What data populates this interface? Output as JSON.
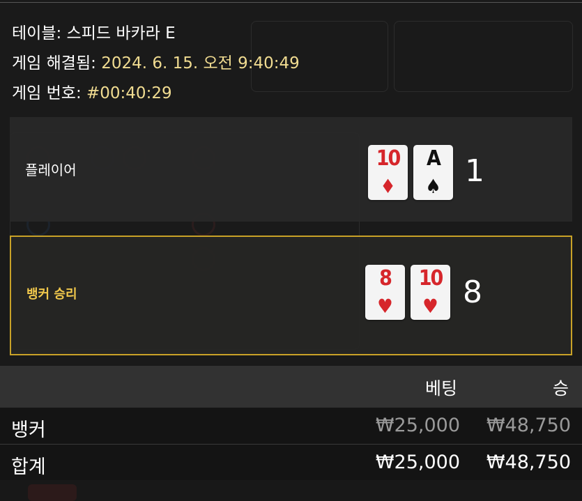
{
  "info": {
    "table_label": "테이블:",
    "table_value": "스피드 바카라 E",
    "time_label": "게임 해결됨:",
    "time_value": "2024. 6. 15. 오전 9:40:49",
    "round_label": "게임 번호:",
    "round_value": "#00:40:29"
  },
  "player": {
    "label": "플레이어",
    "score": "1",
    "cards": [
      {
        "rank": "10",
        "suit": "♦",
        "color": "red"
      },
      {
        "rank": "A",
        "suit": "♠",
        "color": "black"
      }
    ]
  },
  "banker": {
    "label": "뱅커 승리",
    "score": "8",
    "cards": [
      {
        "rank": "8",
        "suit": "♥",
        "color": "red"
      },
      {
        "rank": "10",
        "suit": "♥",
        "color": "red"
      }
    ]
  },
  "bets": {
    "header_bet": "베팅",
    "header_win": "승",
    "rows": [
      {
        "name": "뱅커",
        "bet": "₩25,000",
        "win": "₩48,750"
      }
    ],
    "total": {
      "name": "합계",
      "bet": "₩25,000",
      "win": "₩48,750"
    }
  },
  "colors": {
    "accent_gold": "#f2c94c",
    "info_value": "#f1dc91",
    "card_red": "#d6262b"
  }
}
